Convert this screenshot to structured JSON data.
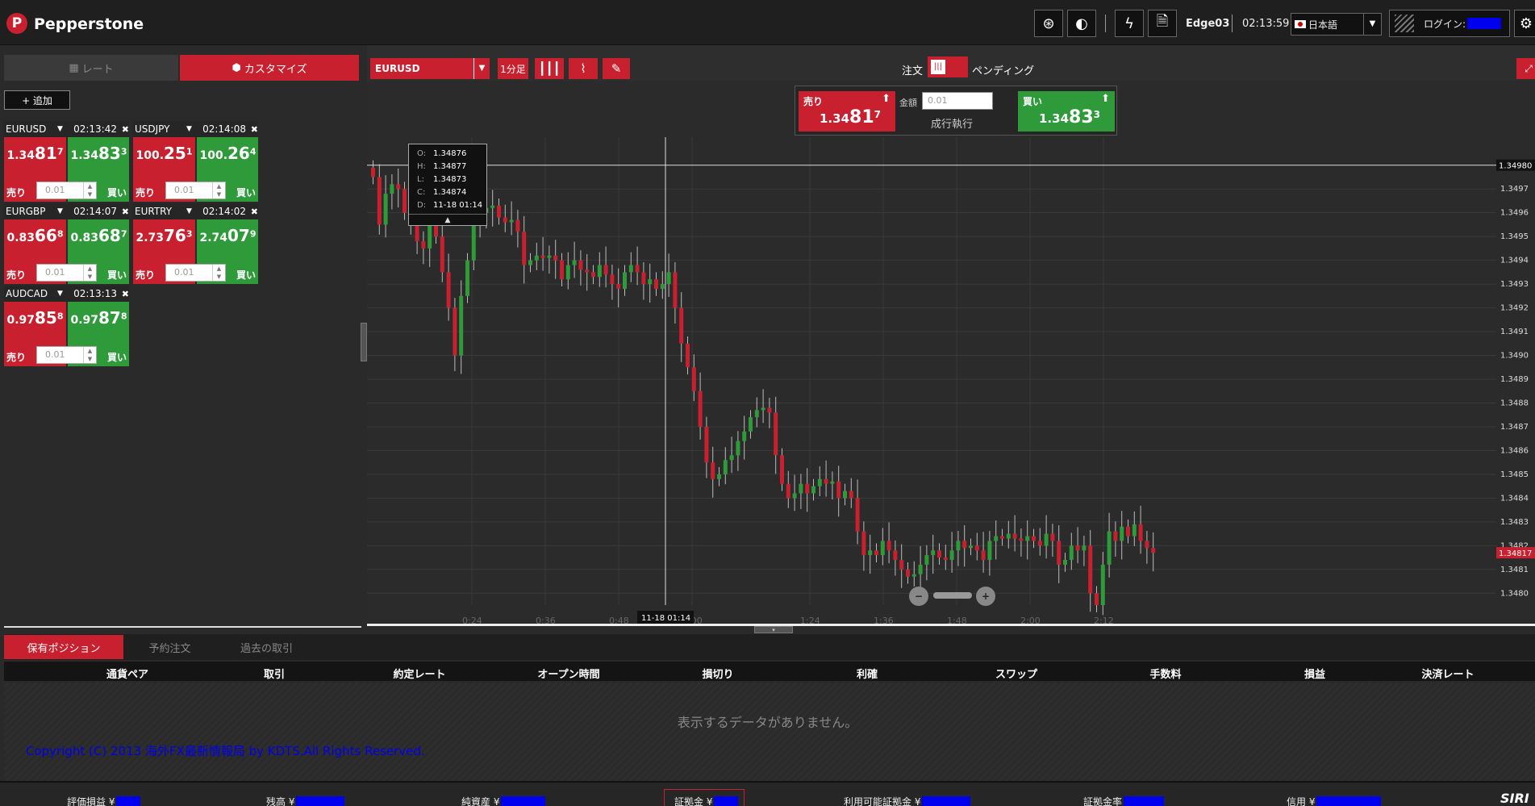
{
  "brand": {
    "logo_letter": "P",
    "name": "Pepperstone"
  },
  "topbar": {
    "account": "Edge03",
    "time": "02:13:59",
    "language": "日本語",
    "login_label": "ログイン:"
  },
  "left_tabs": {
    "rate": "レート",
    "customize": "カスタマイズ"
  },
  "add_button": "+ 追加",
  "quotes": [
    {
      "pair": "EURUSD",
      "time": "02:13:42",
      "sell_pre": "1.34",
      "sell_big": "81",
      "sell_sup": "7",
      "buy_pre": "1.34",
      "buy_big": "83",
      "buy_sup": "3",
      "sell_label": "売り",
      "buy_label": "買い",
      "amount": "0.01"
    },
    {
      "pair": "USDJPY",
      "time": "02:14:08",
      "sell_pre": "100.",
      "sell_big": "25",
      "sell_sup": "1",
      "buy_pre": "100.",
      "buy_big": "26",
      "buy_sup": "4",
      "sell_label": "売り",
      "buy_label": "買い",
      "amount": "0.01"
    },
    {
      "pair": "EURGBP",
      "time": "02:14:07",
      "sell_pre": "0.83",
      "sell_big": "66",
      "sell_sup": "8",
      "buy_pre": "0.83",
      "buy_big": "68",
      "buy_sup": "7",
      "sell_label": "売り",
      "buy_label": "買い",
      "amount": "0.01"
    },
    {
      "pair": "EURTRY",
      "time": "02:14:02",
      "sell_pre": "2.73",
      "sell_big": "76",
      "sell_sup": "3",
      "buy_pre": "2.74",
      "buy_big": "07",
      "buy_sup": "9",
      "sell_label": "売り",
      "buy_label": "買い",
      "amount": "0.01"
    },
    {
      "pair": "AUDCAD",
      "time": "02:13:13",
      "sell_pre": "0.97",
      "sell_big": "85",
      "sell_sup": "8",
      "buy_pre": "0.97",
      "buy_big": "87",
      "buy_sup": "8",
      "sell_label": "売り",
      "buy_label": "買い",
      "amount": "0.01"
    }
  ],
  "chart_toolbar": {
    "symbol": "EURUSD",
    "timeframe": "1分足",
    "order_label": "注文",
    "pending_label": "ペンディング"
  },
  "order_panel": {
    "sell_label": "売り",
    "sell_pre": "1.34",
    "sell_big": "81",
    "sell_sup": "7",
    "buy_label": "買い",
    "buy_pre": "1.34",
    "buy_big": "83",
    "buy_sup": "3",
    "amount_label": "金額",
    "amount": "0.01",
    "exec_label": "成行執行"
  },
  "tooltip": {
    "o_label": "O:",
    "o": "1.34876",
    "h_label": "H:",
    "h": "1.34877",
    "l_label": "L:",
    "l": "1.34873",
    "c_label": "C:",
    "c": "1.34874",
    "d_label": "D:",
    "d": "11-18 01:14"
  },
  "crosshair": {
    "price": "1.34980",
    "time": "11-18 01:14",
    "current_price": "1.34817"
  },
  "chart_data": {
    "type": "candlestick",
    "symbol": "EURUSD",
    "ylim": [
      1.34795,
      1.34985
    ],
    "y_ticks": [
      "1.3497",
      "1.3496",
      "1.3495",
      "1.3494",
      "1.3493",
      "1.3492",
      "1.3491",
      "1.3490",
      "1.3489",
      "1.3488",
      "1.3487",
      "1.3486",
      "1.3485",
      "1.3484",
      "1.3483",
      "1.3482",
      "1.3481",
      "1.3480"
    ],
    "x_ticks": [
      "0:24",
      "0:36",
      "0:48",
      "1:00",
      "1:24",
      "1:36",
      "1:48",
      "2:00",
      "2:12"
    ],
    "candles_close": [
      1.34975,
      1.34955,
      1.34968,
      1.34972,
      1.3497,
      1.3496,
      1.34955,
      1.34948,
      1.34945,
      1.34958,
      1.3495,
      1.34935,
      1.3492,
      1.349,
      1.34925,
      1.3494,
      1.34955,
      1.3496,
      1.34962,
      1.34963,
      1.34958,
      1.34956,
      1.34957,
      1.34952,
      1.34938,
      1.3494,
      1.34942,
      1.34941,
      1.34942,
      1.3494,
      1.34932,
      1.34938,
      1.3494,
      1.34936,
      1.34935,
      1.34933,
      1.34938,
      1.34934,
      1.3493,
      1.34928,
      1.34935,
      1.34938,
      1.34935,
      1.3493,
      1.34932,
      1.34928,
      1.3493,
      1.34935,
      1.3492,
      1.34905,
      1.34895,
      1.34885,
      1.3487,
      1.34855,
      1.34848,
      1.3485,
      1.34856,
      1.34858,
      1.34864,
      1.34868,
      1.34874,
      1.34877,
      1.34878,
      1.34876,
      1.34858,
      1.34846,
      1.3484,
      1.34842,
      1.34846,
      1.34842,
      1.34845,
      1.34848,
      1.34846,
      1.34847,
      1.3484,
      1.34843,
      1.3484,
      1.34826,
      1.34816,
      1.34818,
      1.34816,
      1.34822,
      1.34818,
      1.34814,
      1.3481,
      1.34807,
      1.34808,
      1.34812,
      1.34816,
      1.34818,
      1.34815,
      1.34814,
      1.34818,
      1.34822,
      1.34819,
      1.3482,
      1.34818,
      1.34814,
      1.34822,
      1.34824,
      1.34823,
      1.34825,
      1.34823,
      1.34822,
      1.34824,
      1.34822,
      1.3482,
      1.34825,
      1.34822,
      1.34812,
      1.34814,
      1.3482,
      1.34818,
      1.3482,
      1.348,
      1.34795,
      1.34812,
      1.34826,
      1.34822,
      1.34828,
      1.34824,
      1.34829,
      1.34822,
      1.34819,
      1.34817
    ]
  },
  "bottom_tabs": {
    "positions": "保有ポジション",
    "pending": "予約注文",
    "history": "過去の取引"
  },
  "columns": [
    "通貨ペア",
    "取引",
    "約定レート",
    "オープン時間",
    "損切り",
    "利確",
    "スワップ",
    "手数料",
    "損益",
    "決済レート"
  ],
  "empty_message": "表示するデータがありません。",
  "copyright": "Copyright (C) 2013 海外FX最新情報局 by KDTS.All Rights Reserved.",
  "footer": {
    "pl": "評価損益 ¥",
    "balance": "残高 ¥",
    "equity": "純資産 ¥",
    "margin": "証拠金 ¥",
    "free_margin": "利用可能証拠金 ¥",
    "margin_level": "証拠金率",
    "credit": "信用 ¥",
    "sirix": "SIRI"
  }
}
